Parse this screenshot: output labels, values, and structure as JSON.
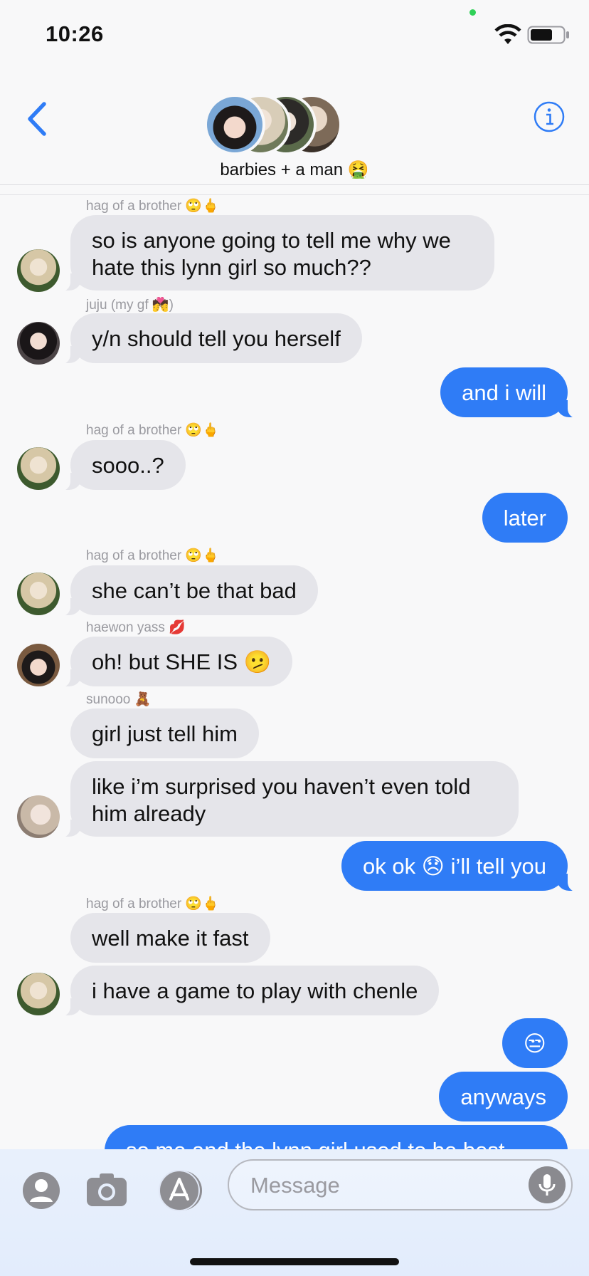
{
  "status": {
    "time": "10:26"
  },
  "header": {
    "title": "barbies + a man 🤮"
  },
  "senders": {
    "hag": "hag of a brother 🙄🖕",
    "juju": "juju (my gf 💏)",
    "haewon": "haewon yass 💋",
    "sunooo": "sunooo 🧸"
  },
  "messages": [
    {
      "dir": "in",
      "text1": "so is anyone going to tell me why we",
      "text2": "hate this lynn girl so much??"
    },
    {
      "dir": "in",
      "text": "y/n should tell you herself"
    },
    {
      "dir": "out",
      "text": "and i will"
    },
    {
      "dir": "in",
      "text": "sooo..?"
    },
    {
      "dir": "out",
      "text": "later"
    },
    {
      "dir": "in",
      "text": "she can’t be that bad"
    },
    {
      "dir": "in",
      "text": "oh! but SHE IS 🫤"
    },
    {
      "dir": "in",
      "text": "girl just tell him"
    },
    {
      "dir": "in",
      "text1": "like i’m surprised you haven’t even told",
      "text2": "him already"
    },
    {
      "dir": "out",
      "text": "ok ok 😞 i’ll tell you"
    },
    {
      "dir": "in",
      "text": "well make it fast"
    },
    {
      "dir": "in",
      "text": "i have a game to play with chenle"
    },
    {
      "dir": "out",
      "text": "😒"
    },
    {
      "dir": "out",
      "text": "anyways"
    },
    {
      "dir": "out",
      "text": "so me and the lynn girl used to be best"
    }
  ],
  "input": {
    "placeholder": "Message"
  },
  "colors": {
    "outgoing": "#2f7cf6",
    "incoming": "#e5e5ea",
    "accent": "#2f7cf6"
  },
  "icons": {
    "back": "chevron-left-icon",
    "info": "info-icon",
    "contacts": "person-icon",
    "camera": "camera-icon",
    "apps": "app-store-icon",
    "mic": "microphone-icon"
  }
}
